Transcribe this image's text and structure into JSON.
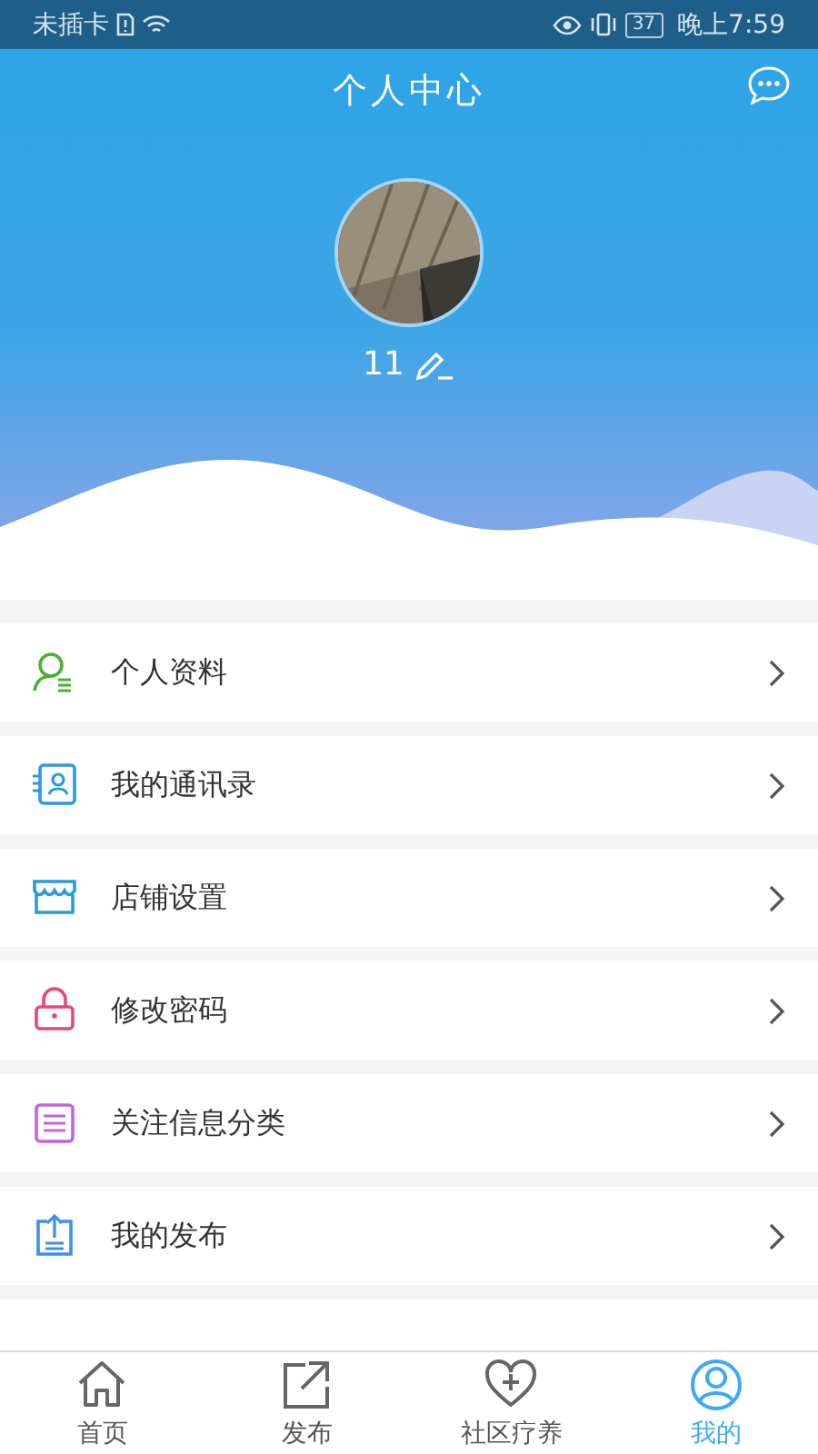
{
  "status_bar": {
    "carrier": "未插卡",
    "battery": "37",
    "time": "晚上7:59"
  },
  "header": {
    "title": "个人中心",
    "username": "11"
  },
  "menu": [
    {
      "label": "个人资料",
      "color": "#4caf34"
    },
    {
      "label": "我的通讯录",
      "color": "#2b9be0"
    },
    {
      "label": "店铺设置",
      "color": "#2b9be0"
    },
    {
      "label": "修改密码",
      "color": "#e8457f"
    },
    {
      "label": "关注信息分类",
      "color": "#c264e0"
    },
    {
      "label": "我的发布",
      "color": "#3d8fe8"
    }
  ],
  "tabs": [
    {
      "label": "首页",
      "selected": false
    },
    {
      "label": "发布",
      "selected": false
    },
    {
      "label": "社区疗养",
      "selected": false
    },
    {
      "label": "我的",
      "selected": true
    }
  ]
}
